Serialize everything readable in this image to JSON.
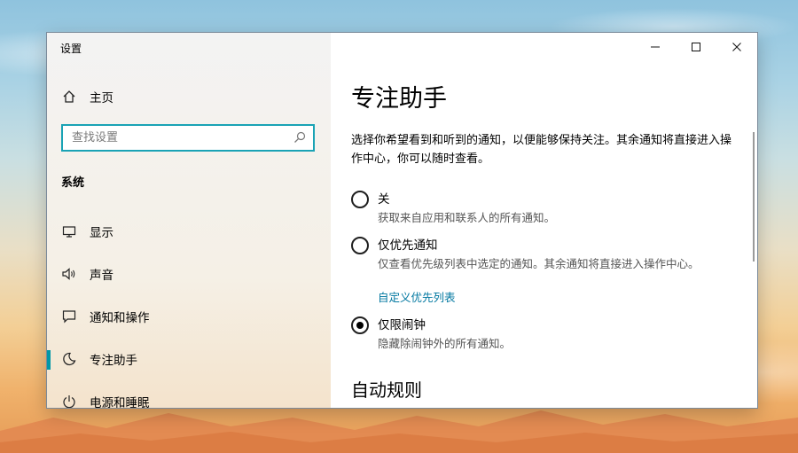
{
  "window": {
    "title": "设置",
    "controls": {
      "minimize": "—",
      "maximize": "☐",
      "close": "✕"
    }
  },
  "sidebar": {
    "home_label": "主页",
    "search_placeholder": "查找设置",
    "section_title": "系统",
    "items": [
      {
        "label": "显示",
        "icon": "monitor-icon"
      },
      {
        "label": "声音",
        "icon": "speaker-icon"
      },
      {
        "label": "通知和操作",
        "icon": "notification-icon"
      },
      {
        "label": "专注助手",
        "icon": "moon-icon",
        "active": true
      },
      {
        "label": "电源和睡眠",
        "icon": "power-icon"
      }
    ]
  },
  "main": {
    "title": "专注助手",
    "description": "选择你希望看到和听到的通知，以便能够保持关注。其余通知将直接进入操作中心，你可以随时查看。",
    "options": [
      {
        "label": "关",
        "description": "获取来自应用和联系人的所有通知。",
        "selected": false
      },
      {
        "label": "仅优先通知",
        "description": "仅查看优先级列表中选定的通知。其余通知将直接进入操作中心。",
        "link": "自定义优先列表",
        "selected": false
      },
      {
        "label": "仅限闹钟",
        "description": "隐藏除闹钟外的所有通知。",
        "selected": true
      }
    ],
    "auto_rules_title": "自动规则"
  },
  "colors": {
    "accent": "#0097a7",
    "link": "#0077a0"
  }
}
